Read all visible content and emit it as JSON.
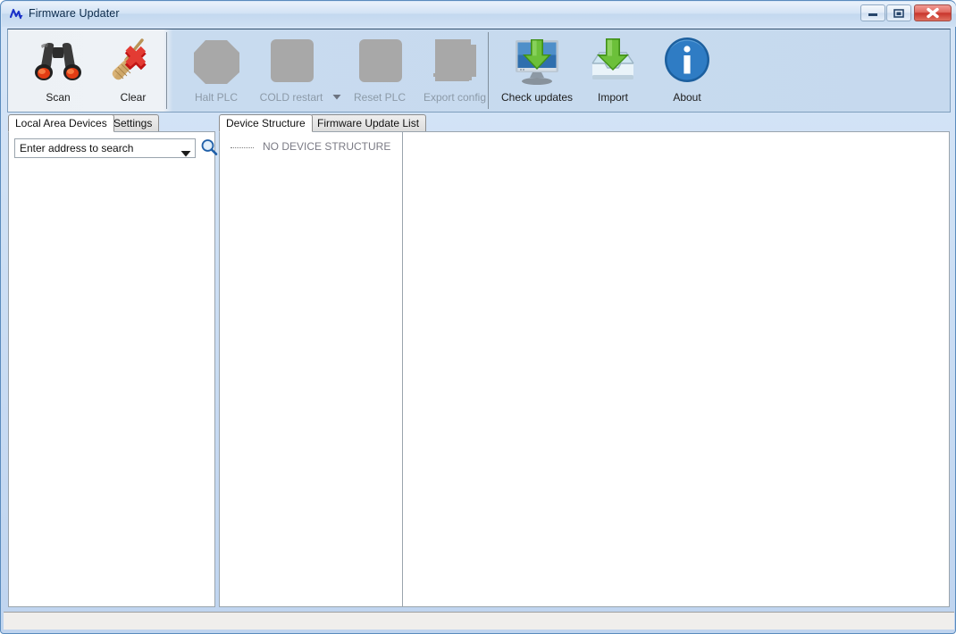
{
  "window": {
    "title": "Firmware Updater",
    "icon": "waveform-icon",
    "controls": {
      "minimize": "minimize-icon",
      "maximize": "maximize-icon",
      "close": "close-icon"
    }
  },
  "toolbar": {
    "buttons": [
      {
        "label": "Scan",
        "icon": "binoculars-icon",
        "enabled": true
      },
      {
        "label": "Clear",
        "icon": "broom-delete-icon",
        "enabled": true
      },
      {
        "label": "Halt PLC",
        "icon": "octagon-stop-icon",
        "enabled": false
      },
      {
        "label": "COLD restart",
        "icon": "rounded-square-icon",
        "enabled": false
      },
      {
        "label": "Reset PLC",
        "icon": "rounded-square-icon",
        "enabled": false
      },
      {
        "label": "Export config",
        "icon": "document-export-icon",
        "enabled": false
      },
      {
        "label": "Check updates",
        "icon": "monitor-download-icon",
        "enabled": true
      },
      {
        "label": "Import",
        "icon": "inbox-download-icon",
        "enabled": true
      },
      {
        "label": "About",
        "icon": "info-circle-icon",
        "enabled": true
      }
    ],
    "overflow_icon": "chevron-down-icon"
  },
  "left_panel": {
    "tabs": [
      {
        "label": "Local Area Devices",
        "active": true
      },
      {
        "label": "Settings",
        "active": false
      }
    ],
    "search": {
      "value": "Enter address to search",
      "placeholder": "Enter address to search",
      "dropdown_icon": "chevron-down-icon",
      "search_icon": "magnifier-icon"
    }
  },
  "right_panel": {
    "tabs": [
      {
        "label": "Device Structure",
        "active": true
      },
      {
        "label": "Firmware Update List",
        "active": false
      }
    ],
    "tree": {
      "root_label": "NO DEVICE STRUCTURE"
    }
  },
  "statusbar": {
    "text": ""
  },
  "colors": {
    "toolbar_blue": "#c6d9ee",
    "title_blue": "#cfe0f3",
    "window_border": "#5a8bbd",
    "accent_green": "#4fa62b",
    "accent_blue": "#2a6fb5",
    "disabled_grey": "#a8a8a8",
    "tree_text_grey": "#7b7b85"
  }
}
